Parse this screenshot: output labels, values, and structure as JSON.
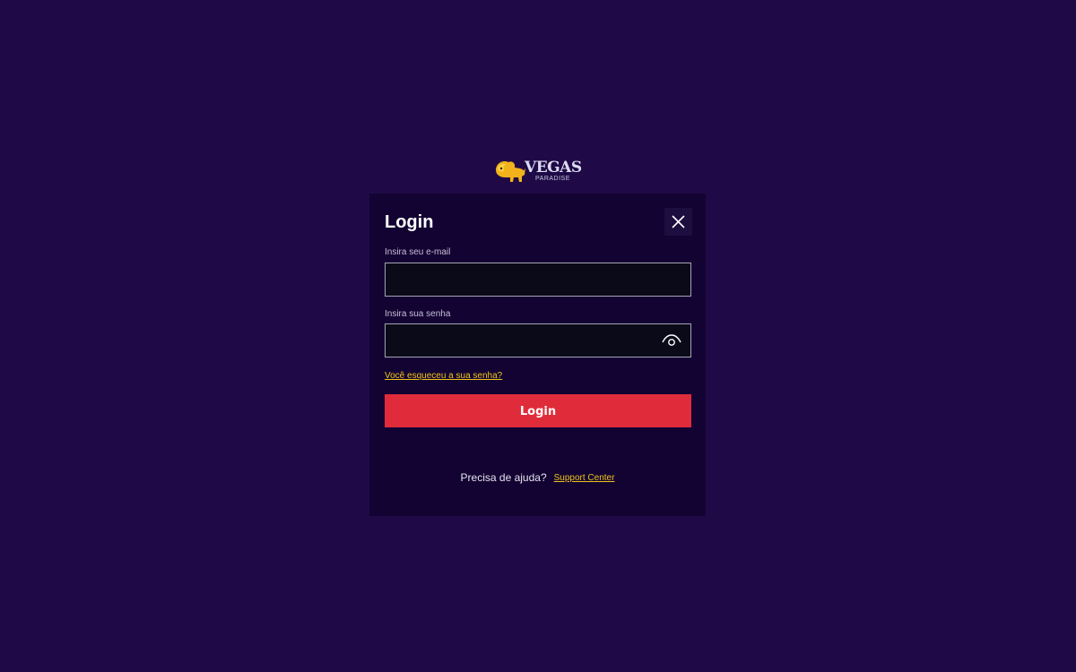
{
  "logo": {
    "brand": "VEGAS",
    "sub": "PARADISE"
  },
  "modal": {
    "title": "Login",
    "email_label": "Insira seu e-mail",
    "email_value": "",
    "password_label": "Insira sua senha",
    "password_value": "",
    "forgot_link": "Você esqueceu a sua senha?",
    "login_button": "Login",
    "help_text": "Precisa de ajuda?",
    "support_link": "Support Center"
  },
  "colors": {
    "background": "#1f0a47",
    "modal_bg": "#130333",
    "accent_button": "#e02c3a",
    "link": "#f0c419"
  },
  "icons": {
    "close": "close-icon",
    "eye": "eye-icon",
    "logo": "lion-logo-icon"
  }
}
